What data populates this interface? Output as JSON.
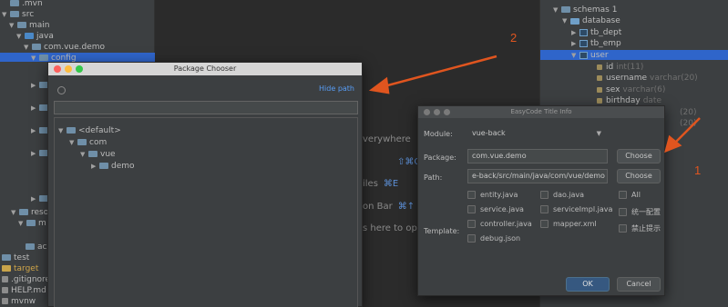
{
  "left_tree": [
    {
      "label": ".mvn",
      "depth": 0,
      "arrow": "",
      "icon": "folder"
    },
    {
      "label": "src",
      "depth": 0,
      "arrow": "▼",
      "icon": "folder"
    },
    {
      "label": "main",
      "depth": 1,
      "arrow": "▼",
      "icon": "folder"
    },
    {
      "label": "java",
      "depth": 2,
      "arrow": "▼",
      "icon": "folder-blue"
    },
    {
      "label": "com.vue.demo",
      "depth": 3,
      "arrow": "▼",
      "icon": "folder"
    },
    {
      "label": "config",
      "depth": 4,
      "arrow": "▼",
      "icon": "folder",
      "selected": true
    }
  ],
  "left_bottom": [
    {
      "label": "reso",
      "icon": "folder"
    },
    {
      "label": "m",
      "icon": "folder"
    },
    {
      "label": "ac",
      "icon": "folder"
    },
    {
      "label": "test",
      "icon": "folder"
    },
    {
      "label": "target",
      "icon": "folder-yellow"
    },
    {
      "label": ".gitignore",
      "icon": "file"
    },
    {
      "label": "HELP.md",
      "icon": "file"
    },
    {
      "label": "mvnw",
      "icon": "file"
    }
  ],
  "db_tree": [
    {
      "label": "schemas 1",
      "arrow": "▼",
      "icon": "folder"
    },
    {
      "label": "database",
      "arrow": "▼",
      "icon": "db"
    },
    {
      "label": "tb_dept",
      "arrow": "▶",
      "icon": "table"
    },
    {
      "label": "tb_emp",
      "arrow": "▶",
      "icon": "table"
    },
    {
      "label": "user",
      "arrow": "▼",
      "icon": "table",
      "selected": true
    }
  ],
  "db_columns": [
    {
      "name": "id",
      "type": "int(11)"
    },
    {
      "name": "username",
      "type": "varchar(20)"
    },
    {
      "name": "sex",
      "type": "varchar(6)"
    },
    {
      "name": "birthday",
      "type": "date"
    },
    {
      "name": "",
      "type": "(20)"
    },
    {
      "name": "",
      "type": "(20)"
    }
  ],
  "hints": [
    {
      "text": "verywhere",
      "key": ""
    },
    {
      "text": "",
      "key": "⇧⌘O"
    },
    {
      "text": "iles",
      "key": "⌘E"
    },
    {
      "text": "on Bar",
      "key": "⌘↑"
    },
    {
      "text": "s here to op",
      "key": ""
    }
  ],
  "package_chooser": {
    "title": "Package Chooser",
    "hide_path": "Hide path",
    "path_value": "",
    "tree": [
      {
        "label": "<default>",
        "arrow": "▼"
      },
      {
        "label": "com",
        "arrow": "▼"
      },
      {
        "label": "vue",
        "arrow": "▼"
      },
      {
        "label": "demo",
        "arrow": "▶"
      }
    ]
  },
  "easycode": {
    "title": "EasyCode Title Info",
    "module_label": "Module:",
    "module_value": "vue-back",
    "package_label": "Package:",
    "package_value": "com.vue.demo",
    "path_label": "Path:",
    "path_value": "e-back/src/main/java/com/vue/demo",
    "template_label": "Template:",
    "choose_label": "Choose",
    "templates": [
      "entity.java",
      "dao.java",
      "service.java",
      "serviceImpl.java",
      "controller.java",
      "mapper.xml",
      "debug.json"
    ],
    "options": [
      "All",
      "统一配置",
      "禁止提示"
    ],
    "ok_label": "OK",
    "cancel_label": "Cancel"
  },
  "annotations": {
    "one": "1",
    "two": "2"
  },
  "colors": {
    "accent": "#2f65ca",
    "arrow": "#e0551f",
    "link": "#589df6"
  }
}
